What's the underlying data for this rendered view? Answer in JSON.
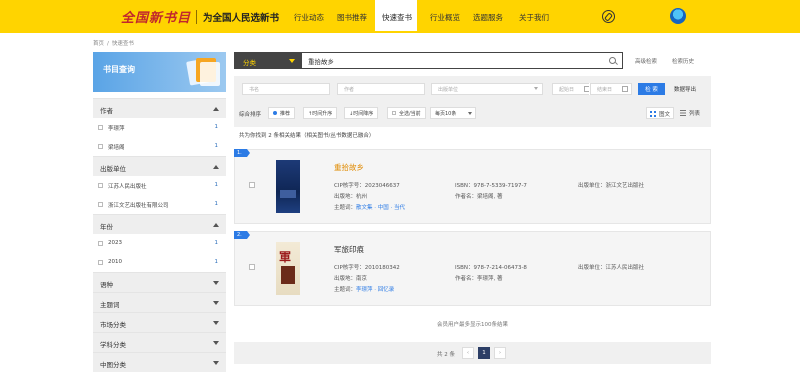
{
  "header": {
    "logo": "全国新书目",
    "slogan": "为全国人民选新书",
    "nav": [
      "行业动态",
      "图书推荐",
      "快速查书",
      "行业概览",
      "选题服务",
      "关于我们"
    ],
    "active_nav": "快速查书"
  },
  "breadcrumb": [
    "首页",
    "快速查书"
  ],
  "sidebar": {
    "banner": "书目查询",
    "facets": [
      {
        "label": "作者",
        "expanded": true,
        "items": [
          {
            "label": "李璟萍",
            "count": "1"
          },
          {
            "label": "梁培阁",
            "count": "1"
          }
        ]
      },
      {
        "label": "出版单位",
        "expanded": true,
        "items": [
          {
            "label": "江苏人民出版社",
            "count": "1"
          },
          {
            "label": "浙江文艺出版社有限公司",
            "count": "1"
          }
        ]
      },
      {
        "label": "年份",
        "expanded": true,
        "items": [
          {
            "label": "2023",
            "count": "1"
          },
          {
            "label": "2010",
            "count": "1"
          }
        ]
      },
      {
        "label": "语种",
        "expanded": false,
        "items": []
      },
      {
        "label": "主题词",
        "expanded": false,
        "items": []
      },
      {
        "label": "市场分类",
        "expanded": false,
        "items": []
      },
      {
        "label": "学科分类",
        "expanded": false,
        "items": []
      },
      {
        "label": "中图分类",
        "expanded": false,
        "items": []
      }
    ]
  },
  "search": {
    "category": "分类",
    "query": "重拾故乡",
    "advanced": "高级检索",
    "history": "检索历史"
  },
  "filters": {
    "title_ph": "书名",
    "author_ph": "作者",
    "publisher_ph": "出版单位",
    "start_ph": "起始日",
    "end_ph": "结束日",
    "search_btn": "检 索",
    "export_btn": "数据导出"
  },
  "sort": {
    "label": "综合排序",
    "buttons": [
      "推荐",
      "时间升序",
      "时间降序",
      "全选/当前"
    ],
    "page_size": "每页10条",
    "view_grid": "图文",
    "view_list": "列表"
  },
  "summary": "共为你找到 2 条相关结果（相关图书/丛书数据已融合）",
  "results": [
    {
      "index": "1.",
      "title": "重拾故乡",
      "cip": "CIP核字号：2023046637",
      "place": "出版地：杭州",
      "subjects_label": "主题词：",
      "subjects": "散文集 · 中国 · 当代",
      "isbn": "ISBN：978-7-5339-7197-7",
      "author": "作者名：梁培阁, 著",
      "publisher": "出版单位：浙江文艺出版社"
    },
    {
      "index": "2.",
      "title": "军旅印痕",
      "cip": "CIP核字号：2010180342",
      "place": "出版地：南京",
      "subjects_label": "主题词：",
      "subjects": "李璟萍 · 回忆录",
      "isbn": "ISBN：978-7-214-06473-8",
      "author": "作者名：李璟萍, 著",
      "publisher": "出版单位：江苏人民出版社"
    }
  ],
  "limit_note": "会员用户最多显示100条结果",
  "pagination": {
    "total": "共 2 条",
    "prev": "‹",
    "current": "1",
    "next": "›"
  },
  "colors": {
    "brand_yellow": "#ffd400",
    "accent_blue": "#2c7be5",
    "title_orange": "#e08a00"
  }
}
